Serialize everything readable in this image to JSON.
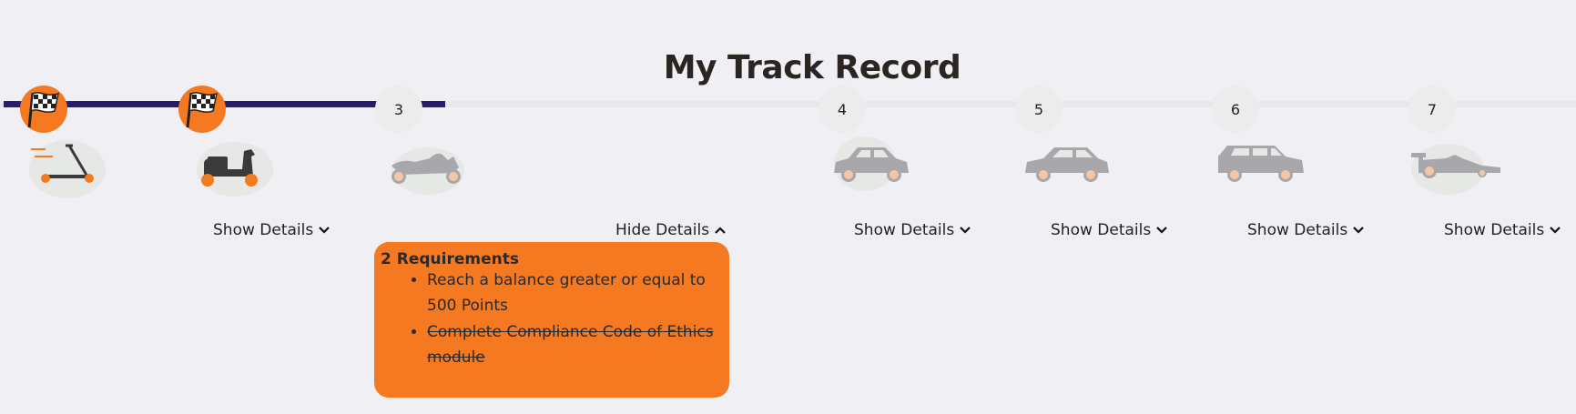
{
  "page": {
    "title": "My Track Record"
  },
  "progress": {
    "current_level": 3,
    "completed_levels": 2,
    "total_levels": 7
  },
  "levels": [
    {
      "number": "1",
      "status": "completed",
      "vehicle": "kick-scooter"
    },
    {
      "number": "2",
      "status": "completed",
      "vehicle": "motor-scooter",
      "details_label": "Show Details"
    },
    {
      "number": "3",
      "status": "current",
      "vehicle": "motorcycle",
      "details_label": "Hide Details"
    },
    {
      "number": "4",
      "status": "locked",
      "vehicle": "hatchback-car",
      "details_label": "Show Details"
    },
    {
      "number": "5",
      "status": "locked",
      "vehicle": "sedan-car",
      "details_label": "Show Details"
    },
    {
      "number": "6",
      "status": "locked",
      "vehicle": "suv-car",
      "details_label": "Show Details"
    },
    {
      "number": "7",
      "status": "locked",
      "vehicle": "race-car",
      "details_label": "Show Details"
    }
  ],
  "requirements_panel": {
    "title": "2 Requirements",
    "items": [
      {
        "text": "Reach a balance greater or equal to 500 Points",
        "completed": false
      },
      {
        "text": "Complete Compliance Code of Ethics module",
        "completed": true
      }
    ]
  },
  "colors": {
    "accent": "#f47920",
    "track_fill": "#2a1a6e",
    "track_empty": "#e8e8ec",
    "node_pending": "#ececec",
    "vehicle_active": "#3a3a3a",
    "vehicle_locked": "#a8a8ac",
    "background": "#f0f0f4"
  },
  "icons": {
    "completed_node": "checkered-flag-icon",
    "details_expand": "chevron-down-icon",
    "details_collapse": "chevron-up-icon"
  }
}
